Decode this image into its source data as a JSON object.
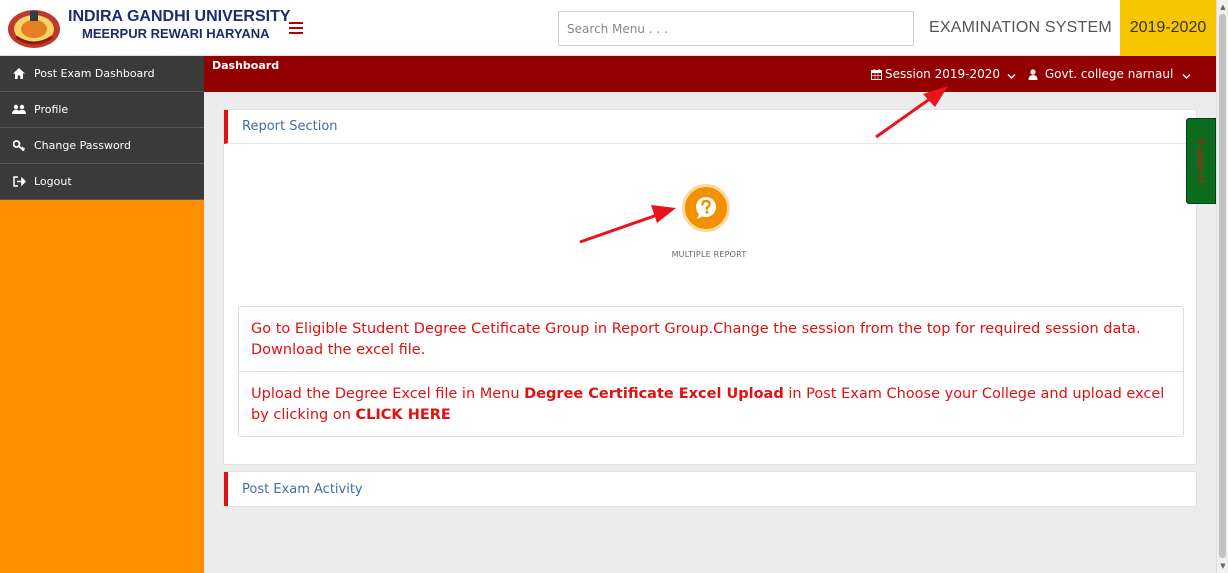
{
  "header": {
    "university_line1": "INDIRA GANDHI UNIVERSITY",
    "university_line2": "MEERPUR REWARI HARYANA",
    "search_placeholder": "Search Menu . . .",
    "system_title": "EXAMINATION SYSTEM",
    "year_badge": "2019-2020"
  },
  "navbar": {
    "breadcrumb": "Dashboard",
    "session_label": "Session",
    "session_value": "2019-2020",
    "user_name": "Govt. college narnaul"
  },
  "sidebar": {
    "items": [
      {
        "label": "Post Exam Dashboard",
        "icon": "home-icon"
      },
      {
        "label": "Profile",
        "icon": "users-icon"
      },
      {
        "label": "Change Password",
        "icon": "key-icon"
      },
      {
        "label": "Logout",
        "icon": "sign-out-icon"
      }
    ]
  },
  "report_section": {
    "title": "Report Section",
    "button_label": "MULTIPLE REPORT",
    "info1": "Go to Eligible Student Degree Cetificate Group in Report Group.Change the session from the top for required session data. Download the excel file.",
    "info2_part1": "Upload the Degree Excel file in Menu ",
    "info2_bold": "Degree Certificate Excel Upload",
    "info2_part2": " in Post Exam Choose your College and upload excel by clicking on ",
    "info2_link": "CLICK HERE"
  },
  "post_exam": {
    "title": "Post Exam Activity"
  },
  "support_tab": {
    "label": "Support"
  },
  "colors": {
    "navbar_red": "#930000",
    "sidebar_orange": "#ff8f00",
    "badge_yellow": "#f7c600",
    "accent_red": "#e21010",
    "heading_blue": "#3f6fa8",
    "report_button": "#f29100"
  }
}
